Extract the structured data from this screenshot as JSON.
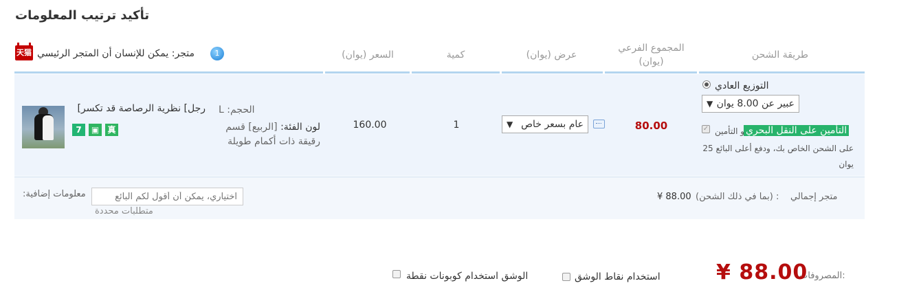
{
  "page": {
    "title": "تأكيد ترتيب المعلومات"
  },
  "table_headers": {
    "shipping": "طريقة الشحن",
    "subtotal_line1": "المجموع الفرعي",
    "subtotal_line2": "(يوان)",
    "offer": "(عرض (يوان",
    "quantity": "كمية",
    "price": "(السعر (يوان"
  },
  "store": {
    "label": "متجر: يمكن للإنسان أن المتجر الرئيسي",
    "logo_text": "天猫",
    "chat_icon_text": "1"
  },
  "product": {
    "name": "رجل] نظرية الرصاصة قد تكسر]",
    "badges": [
      "7",
      "▣",
      "真"
    ],
    "size_label": "الحجم:",
    "size_value": "L",
    "color_label": "لون الفئة:",
    "color_value": "[الربيع] قسم رقيقة ذات أكمام طويلة",
    "price": "160.00",
    "quantity": "1",
    "promo_selected": "عام بسعر خاص",
    "subtotal": "80.00"
  },
  "shipping": {
    "normal_label": "التوزيع العادي",
    "selected_option": "عبير عن 8.00 يوان",
    "insurance_tag": "التأمين على النقل البحري",
    "insurance_and": "و التأمين",
    "insurance_desc": "على الشحن الخاص بك، ودفع أعلى البائع 25 يوان",
    "insurance_checked": true
  },
  "store_total": {
    "label": "متجر إجمالي",
    "note": "(بما في ذلك الشحن) :",
    "value": "¥ 88.00"
  },
  "message": {
    "label": ":معلومات إضافية",
    "placeholder": "اختياري، يمكن أن أقول لكم البائع",
    "hint": "متطلبات محددة"
  },
  "footer": {
    "total_label": "المصروفات:",
    "total_value": "¥ 88.00",
    "use_points": "استخدام نقاط الوشق",
    "use_coupons": "الوشق استخدام كوبونات نقطة"
  },
  "colors": {
    "accent_red": "#b50d0d",
    "header_line": "#b3d4ef",
    "row_bg": "#eef4fc",
    "insurance_green": "#27b36b"
  }
}
